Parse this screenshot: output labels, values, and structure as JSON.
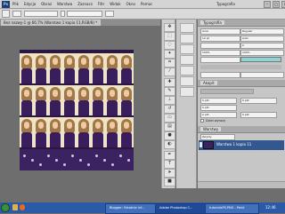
{
  "menubar": {
    "app_icon": "Ps",
    "items": [
      "Plik",
      "Edycja",
      "Obraz",
      "Warstwa",
      "Zaznacz",
      "Filtr",
      "Widok",
      "Okno",
      "Pomoc"
    ],
    "workspace": "Typografia",
    "window_controls": [
      "–",
      "□",
      "×"
    ]
  },
  "document_tab": {
    "label": "Bez nazwy-1 @ 66,7% (Warstwa 1 kopia 11,RGB/8) *"
  },
  "panels": {
    "character_tab": "Typografia",
    "paragraph_tab": "Akapit",
    "layers_tab": "Warstwy",
    "font_family": "Arial",
    "font_style": "Regular",
    "font_size": "12 pt",
    "leading": "Auto",
    "tracking": "0",
    "scale": "100%",
    "indent_value": "0 pkt",
    "hyphenate_label": "Dziel wyrazy",
    "blend_mode": "Zwykły",
    "layer_name": "Warstwa 1 kopia 11"
  },
  "taskbar": {
    "items": [
      "Blogger: Ostatnie inf...",
      "Adobe Photoshop C...",
      "tutorialsPS.PNG - Paint"
    ],
    "clock": "12:46"
  },
  "colors": {
    "dress": "#3a1d5c",
    "hair": "#a07845",
    "selected_layer": "#33588f",
    "taskbar": "#2b5aa8"
  }
}
